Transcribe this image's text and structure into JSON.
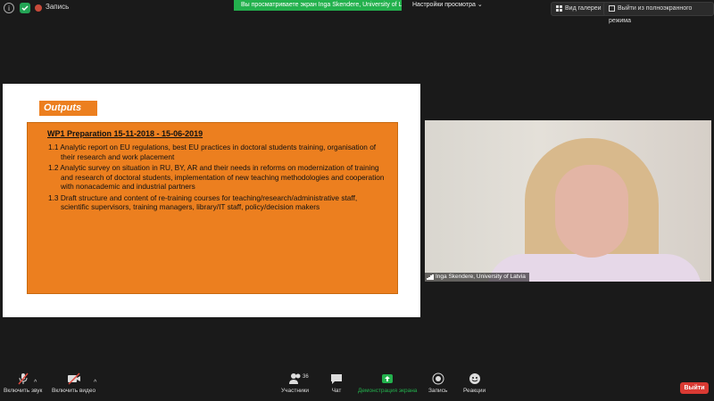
{
  "topbar": {
    "record_label": "Запись",
    "share_banner": "Вы просматриваете экран Inga Skendere, University of L...",
    "view_settings": "Настройки просмотра",
    "gallery_label": "Вид галереи",
    "exit_fullscreen_label": "Выйти из полноэкранного режима"
  },
  "slide": {
    "outputs_label": "Outputs",
    "wp_title": "WP1 Preparation 15-11-2018 - 15-06-2019",
    "items": [
      "1.1 Analytic report on EU regulations, best EU practices in doctoral students training, organisation of their research and work placement",
      "1.2 Analytic survey on situation in RU, BY, AR and their needs in reforms on modernization of training and research of doctoral  students, implementation of new teaching methodologies and cooperation with nonacademic and industrial partners",
      "1.3 Draft structure and content of re-training courses for teaching/research/administrative staff, scientific supervisors, training managers, library/IT staff, policy/decision makers"
    ]
  },
  "video": {
    "participant_name": "Inga Skendere, University of Latvia"
  },
  "toolbar": {
    "unmute_label": "Включить звук",
    "start_video_label": "Включить видео",
    "participants_label": "Участники",
    "participants_count": "36",
    "chat_label": "Чат",
    "share_screen_label": "Демонстрация экрана",
    "record_label": "Запись",
    "reactions_label": "Реакции",
    "leave_label": "Выйти"
  },
  "colors": {
    "slide_orange": "#ec7f1f",
    "share_green": "#23b14d",
    "leave_red": "#d93a33",
    "background": "#1a1a1a"
  }
}
